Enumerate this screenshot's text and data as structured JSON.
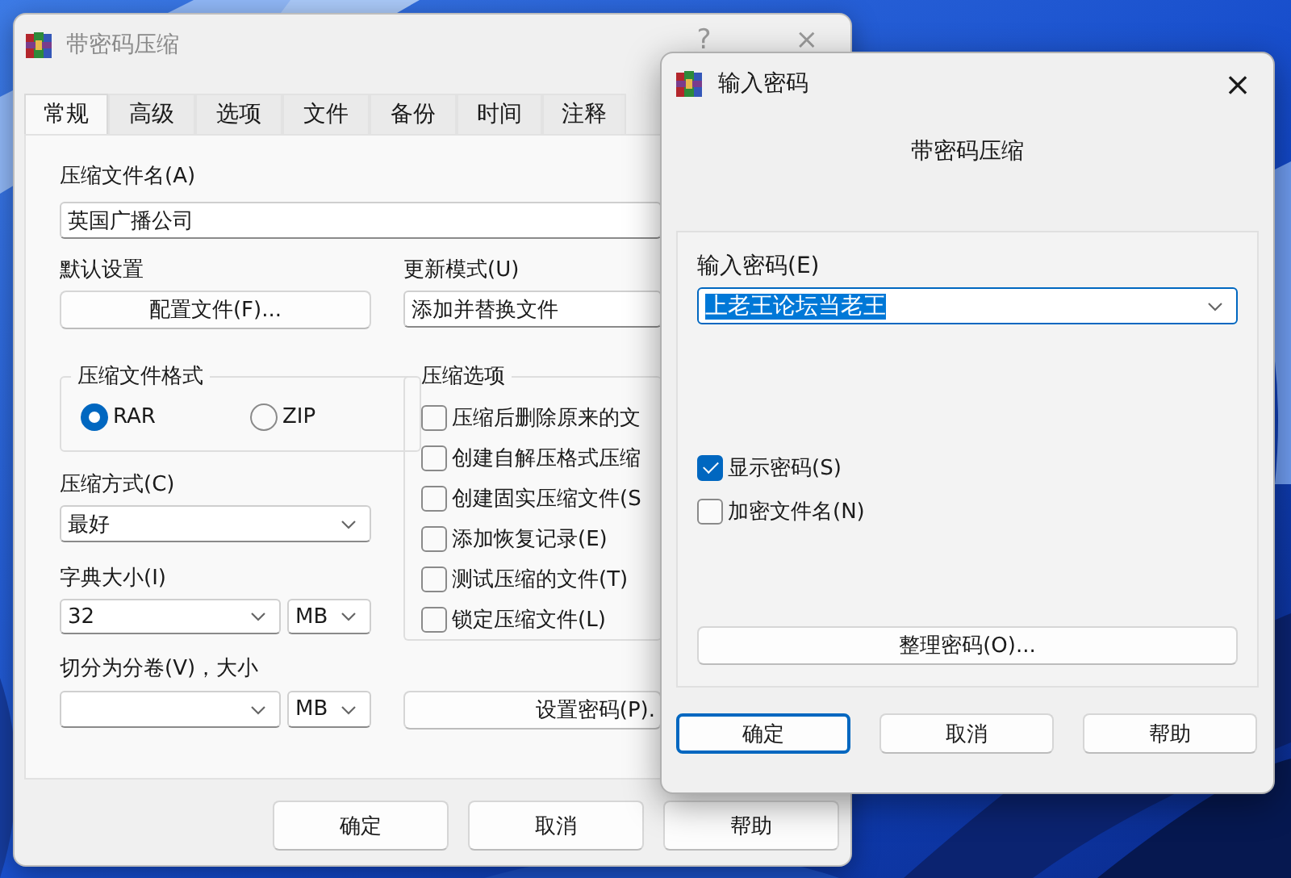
{
  "main_window": {
    "title": "带密码压缩",
    "help_button": "?",
    "close_button": "×",
    "tabs": [
      {
        "label": "常规",
        "selected": true
      },
      {
        "label": "高级",
        "selected": false
      },
      {
        "label": "选项",
        "selected": false
      },
      {
        "label": "文件",
        "selected": false
      },
      {
        "label": "备份",
        "selected": false
      },
      {
        "label": "时间",
        "selected": false
      },
      {
        "label": "注释",
        "selected": false
      }
    ],
    "archive_name": {
      "label": "压缩文件名(A)",
      "value": "英国广播公司"
    },
    "default_settings": {
      "label": "默认设置",
      "button": "配置文件(F)..."
    },
    "update_mode": {
      "label": "更新模式(U)",
      "value": "添加并替换文件"
    },
    "archive_format": {
      "title": "压缩文件格式",
      "options": [
        {
          "label": "RAR",
          "selected": true
        },
        {
          "label": "ZIP",
          "selected": false
        }
      ]
    },
    "compression_method": {
      "label": "压缩方式(C)",
      "value": "最好"
    },
    "dictionary_size": {
      "label": "字典大小(I)",
      "value": "32",
      "unit": "MB"
    },
    "split_volumes": {
      "label": "切分为分卷(V)，大小",
      "unit": "MB"
    },
    "compression_options": {
      "title": "压缩选项",
      "items": [
        {
          "label": "压缩后删除原来的文",
          "checked": false
        },
        {
          "label": "创建自解压格式压缩",
          "checked": false
        },
        {
          "label": "创建固实压缩文件(S",
          "checked": false
        },
        {
          "label": "添加恢复记录(E)",
          "checked": false
        },
        {
          "label": "测试压缩的文件(T)",
          "checked": false
        },
        {
          "label": "锁定压缩文件(L)",
          "checked": false
        }
      ]
    },
    "set_password_button": "设置密码(P).",
    "buttons": [
      "确定",
      "取消",
      "帮助"
    ]
  },
  "password_dialog": {
    "title": "输入密码",
    "close_button": "×",
    "subtitle": "带密码压缩",
    "password": {
      "label": "输入密码(E)",
      "value": "上老王论坛当老王",
      "highlighted": true
    },
    "checkboxes": [
      {
        "label": "显示密码(S)",
        "checked": true
      },
      {
        "label": "加密文件名(N)",
        "checked": false
      }
    ],
    "organize_button": "整理密码(O)...",
    "buttons": [
      {
        "label": "确定",
        "focused": true
      },
      {
        "label": "取消",
        "focused": false
      },
      {
        "label": "帮助",
        "focused": false
      }
    ]
  }
}
